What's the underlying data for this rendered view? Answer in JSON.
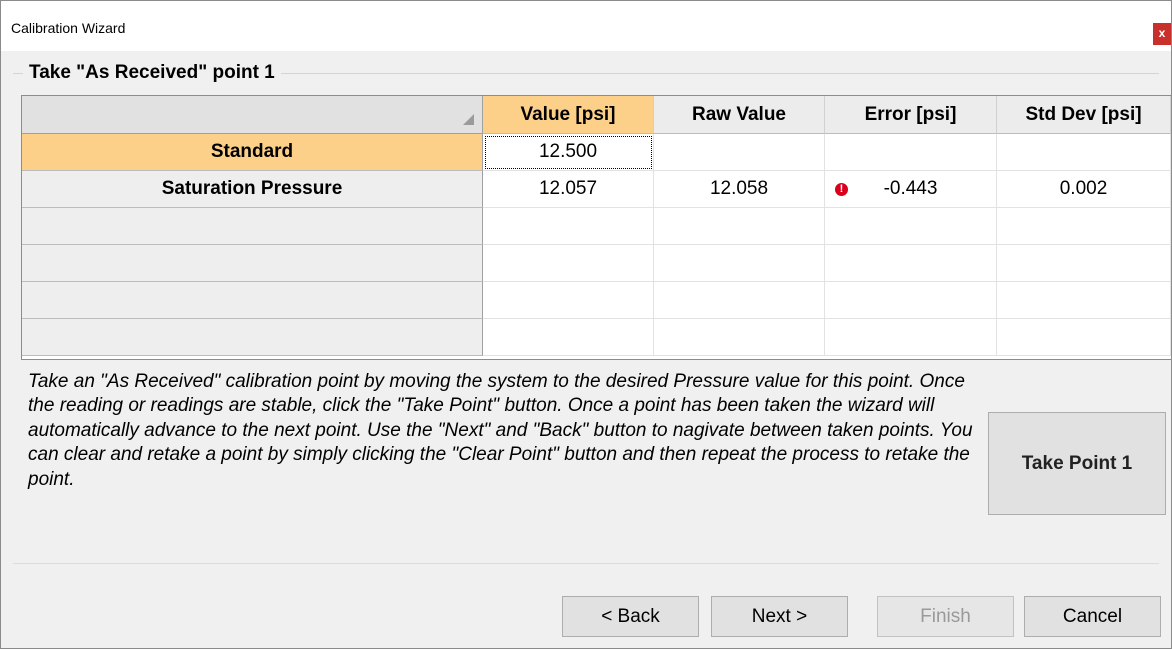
{
  "window": {
    "title": "Calibration Wizard",
    "close_label": "x"
  },
  "group": {
    "title": "Take \"As Received\" point 1"
  },
  "grid": {
    "columns": [
      "Value [psi]",
      "Raw Value",
      "Error [psi]",
      "Std Dev [psi]"
    ],
    "rows": [
      {
        "label": "Standard",
        "values": [
          "12.500",
          "",
          "",
          ""
        ]
      },
      {
        "label": "Saturation Pressure",
        "values": [
          "12.057",
          "12.058",
          "-0.443",
          "0.002"
        ]
      },
      {
        "label": "",
        "values": [
          "",
          "",
          "",
          ""
        ]
      },
      {
        "label": "",
        "values": [
          "",
          "",
          "",
          ""
        ]
      },
      {
        "label": "",
        "values": [
          "",
          "",
          "",
          ""
        ]
      },
      {
        "label": "",
        "values": [
          "",
          "",
          "",
          ""
        ]
      }
    ],
    "error_icon": "exclamation-circle-icon",
    "selected_color": "#fdd08a"
  },
  "description": "Take an \"As Received\" calibration point by moving the system to the desired Pressure value for this point.  Once the reading or readings are stable, click the \"Take Point\" button.  Once a point has been taken the wizard will automatically advance to the next point.  Use the \"Next\" and \"Back\" button to nagivate between taken points.  You can clear and retake a point by simply clicking the \"Clear Point\" button and then repeat the process to retake the point.",
  "take_point_label": "Take Point 1",
  "buttons": {
    "back": "< Back",
    "next": "Next >",
    "finish": "Finish",
    "cancel": "Cancel"
  }
}
